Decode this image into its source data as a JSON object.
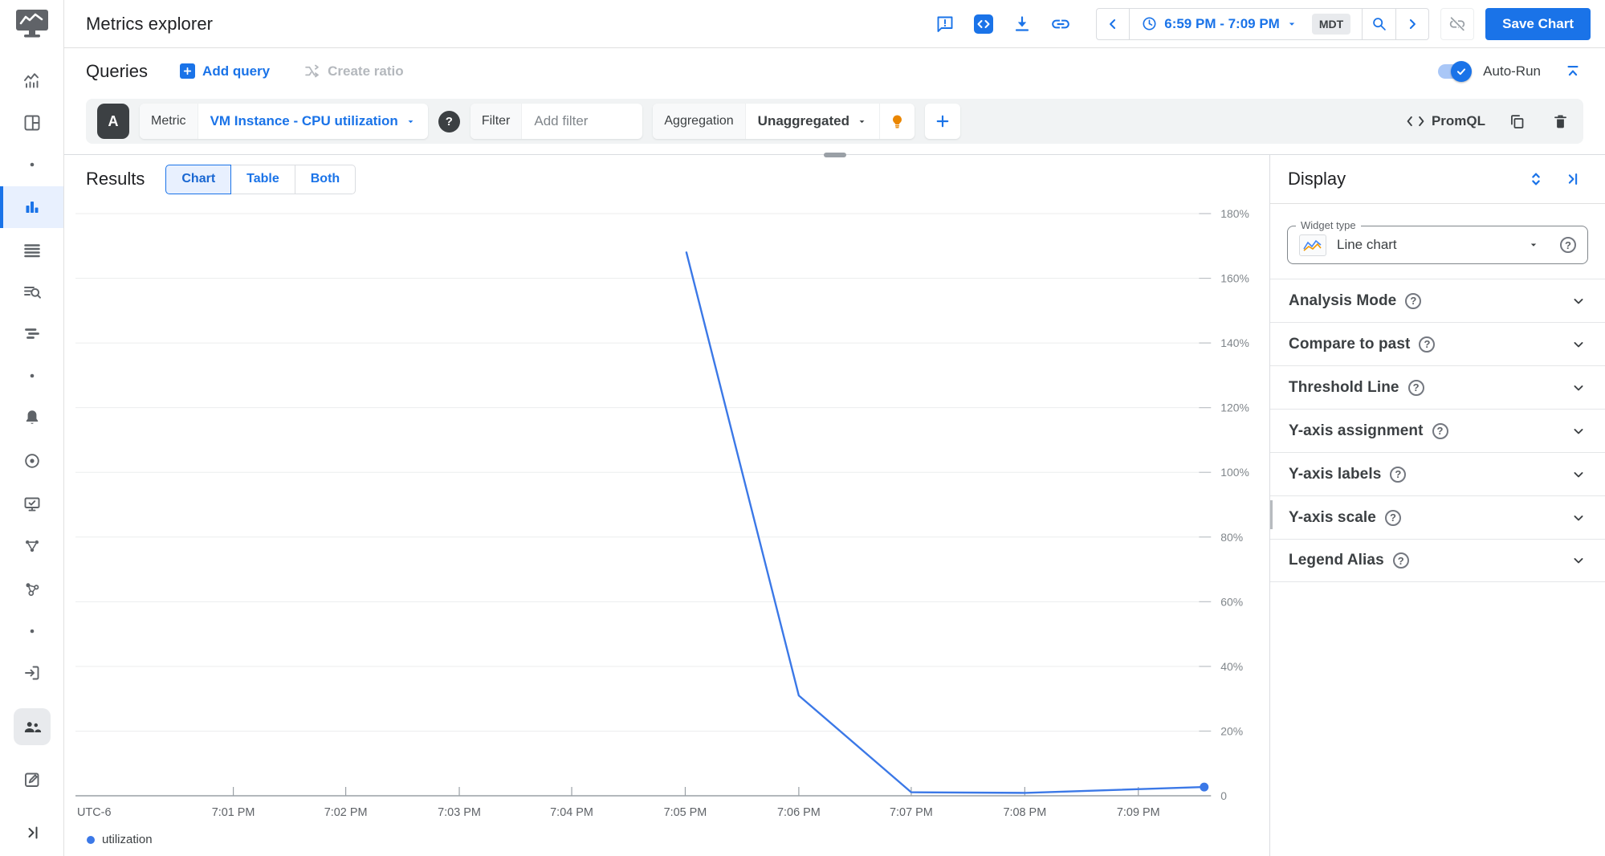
{
  "header": {
    "app_title": "Metrics explorer",
    "time_range": "6:59 PM - 7:09 PM",
    "timezone": "MDT",
    "save_button": "Save Chart"
  },
  "queries": {
    "title": "Queries",
    "add_query": "Add query",
    "create_ratio": "Create ratio",
    "auto_run_label": "Auto-Run",
    "query_letter": "A",
    "metric_label": "Metric",
    "metric_value": "VM Instance - CPU utilization",
    "filter_label": "Filter",
    "filter_placeholder": "Add filter",
    "aggregation_label": "Aggregation",
    "aggregation_value": "Unaggregated",
    "promql_label": "PromQL"
  },
  "results": {
    "title": "Results",
    "tabs": [
      "Chart",
      "Table",
      "Both"
    ],
    "active_tab": "Chart"
  },
  "display": {
    "title": "Display",
    "widget_type_label": "Widget type",
    "widget_type_value": "Line chart",
    "sections": [
      {
        "label": "Analysis Mode"
      },
      {
        "label": "Compare to past"
      },
      {
        "label": "Threshold Line"
      },
      {
        "label": "Y-axis assignment"
      },
      {
        "label": "Y-axis labels"
      },
      {
        "label": "Y-axis scale"
      },
      {
        "label": "Legend Alias"
      }
    ]
  },
  "chart_data": {
    "type": "line",
    "title": "",
    "xlabel": "",
    "ylabel": "",
    "ylim": [
      0,
      180
    ],
    "utc_label": "UTC-6",
    "grid": true,
    "legend_position": "bottom-left",
    "y_ticks": [
      {
        "v": 180,
        "label": "180%"
      },
      {
        "v": 160,
        "label": "160%"
      },
      {
        "v": 140,
        "label": "140%"
      },
      {
        "v": 120,
        "label": "120%"
      },
      {
        "v": 100,
        "label": "100%"
      },
      {
        "v": 80,
        "label": "80%"
      },
      {
        "v": 60,
        "label": "60%"
      },
      {
        "v": 40,
        "label": "40%"
      },
      {
        "v": 20,
        "label": "20%"
      },
      {
        "v": 0,
        "label": "0"
      }
    ],
    "x_ticks": [
      {
        "f": 0.139,
        "label": "7:01 PM"
      },
      {
        "f": 0.238,
        "label": "7:02 PM"
      },
      {
        "f": 0.338,
        "label": "7:03 PM"
      },
      {
        "f": 0.437,
        "label": "7:04 PM"
      },
      {
        "f": 0.537,
        "label": "7:05 PM"
      },
      {
        "f": 0.637,
        "label": "7:06 PM"
      },
      {
        "f": 0.736,
        "label": "7:07 PM"
      },
      {
        "f": 0.836,
        "label": "7:08 PM"
      },
      {
        "f": 0.936,
        "label": "7:09 PM"
      }
    ],
    "series": [
      {
        "name": "utilization",
        "color": "#3b78e7",
        "end_dot": true,
        "points": [
          [
            0.538,
            168
          ],
          [
            0.637,
            31
          ],
          [
            0.736,
            1.1
          ],
          [
            0.836,
            0.9
          ],
          [
            0.994,
            2.7
          ]
        ]
      }
    ]
  },
  "colors": {
    "accent_blue": "#1a73e8",
    "chart_line": "#3b78e7",
    "active_bg": "#e8f0fe",
    "panel_gray": "#f1f3f4",
    "bulb_orange": "#ea8600"
  }
}
